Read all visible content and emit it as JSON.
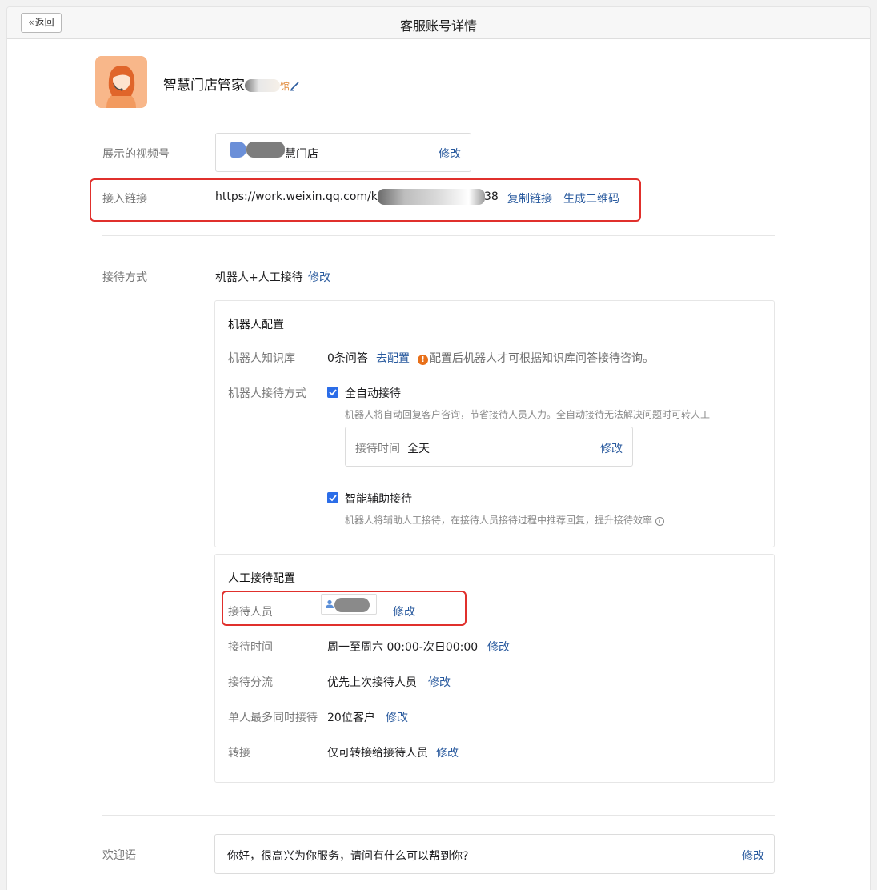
{
  "header": {
    "back_label": "返回",
    "title": "客服账号详情"
  },
  "account": {
    "name": "智慧门店管家",
    "name_suffix": "馆"
  },
  "video_channel": {
    "label": "展示的视频号",
    "name_tail": "慧门店",
    "edit": "修改"
  },
  "access_link": {
    "label": "接入链接",
    "url_prefix": "https://work.weixin.qq.com/kfid/",
    "url_suffix": "38",
    "copy": "复制链接",
    "qrcode": "生成二维码"
  },
  "reception_mode": {
    "label": "接待方式",
    "value": "机器人+人工接待",
    "edit": "修改"
  },
  "robot": {
    "title": "机器人配置",
    "kb_label": "机器人知识库",
    "kb_value": "0条问答",
    "kb_config": "去配置",
    "kb_tip": "配置后机器人才可根据知识库问答接待咨询。",
    "mode_label": "机器人接待方式",
    "auto_label": "全自动接待",
    "auto_desc": "机器人将自动回复客户咨询，节省接待人员人力。全自动接待无法解决问题时可转人工",
    "time_label": "接待时间",
    "time_value": "全天",
    "time_edit": "修改",
    "assist_label": "智能辅助接待",
    "assist_desc": "机器人将辅助人工接待，在接待人员接待过程中推荐回复，提升接待效率"
  },
  "manual": {
    "title": "人工接待配置",
    "staff_label": "接待人员",
    "staff_edit": "修改",
    "time_label": "接待时间",
    "time_value": "周一至周六 00:00-次日00:00",
    "time_edit": "修改",
    "dispatch_label": "接待分流",
    "dispatch_value": "优先上次接待人员",
    "dispatch_edit": "修改",
    "max_label": "单人最多同时接待",
    "max_value": "20位客户",
    "max_edit": "修改",
    "transfer_label": "转接",
    "transfer_value": "仅可转接给接待人员",
    "transfer_edit": "修改"
  },
  "welcome": {
    "label": "欢迎语",
    "text": "你好，很高兴为你服务，请问有什么可以帮到你?",
    "edit": "修改"
  },
  "colors": {
    "link": "#295a9e",
    "checkbox": "#2b6de8",
    "highlight": "#e0302c",
    "warn": "#e8701a"
  }
}
